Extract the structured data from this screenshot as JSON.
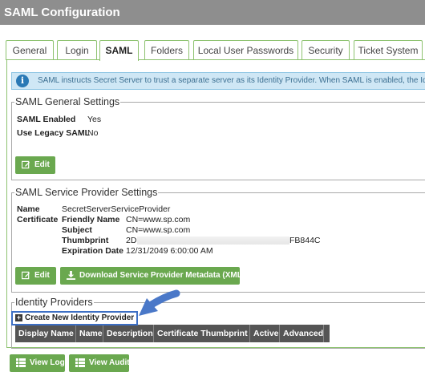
{
  "header": {
    "title": "SAML Configuration"
  },
  "tabs": [
    {
      "label": "General",
      "active": false
    },
    {
      "label": "Login",
      "active": false
    },
    {
      "label": "SAML",
      "active": true
    },
    {
      "label": "Folders",
      "active": false
    },
    {
      "label": "Local User Passwords",
      "active": false
    },
    {
      "label": "Security",
      "active": false
    },
    {
      "label": "Ticket System",
      "active": false
    }
  ],
  "info": {
    "text": "SAML instructs Secret Server to trust a separate server as its Identity Provider. When SAML is enabled, the Identi"
  },
  "general": {
    "legend": "SAML General Settings",
    "enabled_label": "SAML Enabled",
    "enabled_value": "Yes",
    "legacy_label": "Use Legacy SAML",
    "legacy_value": "No",
    "edit_label": "Edit"
  },
  "sp": {
    "legend": "SAML Service Provider Settings",
    "name_label": "Name",
    "name_value": "SecretServerServiceProvider",
    "cert_label": "Certificate",
    "friendly_label": "Friendly Name",
    "friendly_value": "CN=www.sp.com",
    "subject_label": "Subject",
    "subject_value": "CN=www.sp.com",
    "thumb_label": "Thumbprint",
    "thumb_start": "2D",
    "thumb_end": "FB844C",
    "expiry_label": "Expiration Date",
    "expiry_value": "12/31/2049 6:00:00 AM",
    "edit_label": "Edit",
    "download_label": "Download Service Provider Metadata (XML)"
  },
  "idp": {
    "legend": "Identity Providers",
    "create_label": "Create New Identity Provider",
    "columns": [
      "Display Name",
      "Name",
      "Description",
      "Certificate Thumbprint",
      "Active",
      "Advanced"
    ]
  },
  "footer": {
    "view_log_label": "View Log",
    "view_audit_label": "View Audit"
  },
  "colors": {
    "header_bg": "#8e8e8e",
    "tab_border": "#8dc26f",
    "button_green": "#6aa84f",
    "info_bg": "#cfe7f5",
    "highlight_blue": "#3d6fc4",
    "table_header_bg": "#555555"
  },
  "icons": {
    "info": "info-icon",
    "edit": "pencil-square-icon",
    "download": "download-icon",
    "plus": "plus-square-icon",
    "list": "list-icon",
    "arrow": "pointer-arrow-icon"
  }
}
